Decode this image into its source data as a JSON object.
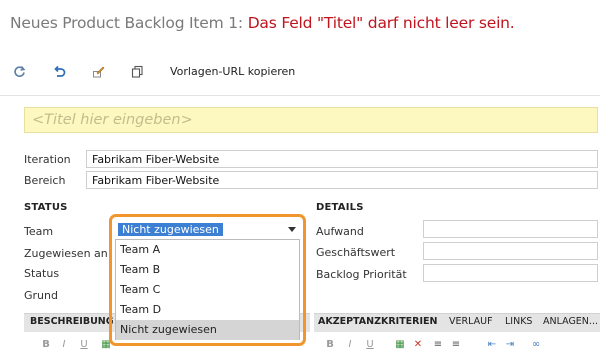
{
  "header": {
    "title": "Neues Product Backlog Item 1:",
    "error": "Das Feld \"Titel\" darf nicht leer sein."
  },
  "toolbar": {
    "copy_template_url": "Vorlagen-URL kopieren",
    "icons": [
      "refresh-icon",
      "undo-icon",
      "edit-icon",
      "copy-icon"
    ]
  },
  "title_field": {
    "placeholder": "<Titel hier eingeben>"
  },
  "fields": {
    "iteration_label": "Iteration",
    "iteration_value": "Fabrikam Fiber-Website",
    "area_label": "Bereich",
    "area_value": "Fabrikam Fiber-Website"
  },
  "status": {
    "heading": "STATUS",
    "team_label": "Team",
    "assigned_label": "Zugewiesen an",
    "state_label": "Status",
    "reason_label": "Grund",
    "team_selected": "Nicht zugewiesen",
    "team_options": [
      "Team A",
      "Team B",
      "Team C",
      "Team D",
      "Nicht zugewiesen"
    ]
  },
  "details": {
    "heading": "DETAILS",
    "effort_label": "Aufwand",
    "business_value_label": "Geschäftswert",
    "backlog_priority_label": "Backlog Priorität"
  },
  "tabs_left": {
    "description": "BESCHREIBUNG"
  },
  "tabs_right": {
    "acceptance": "AKZEPTANZKRITERIEN",
    "history": "VERLAUF",
    "links": "LINKS",
    "attachments": "ANLAGEN..."
  },
  "format_bar": {
    "bold": "B",
    "italic": "I",
    "underline": "U"
  },
  "colors": {
    "error": "#c0141f",
    "highlight": "#f0962d",
    "title_bg": "#fcf8c0",
    "selection": "#3c7fd3"
  }
}
